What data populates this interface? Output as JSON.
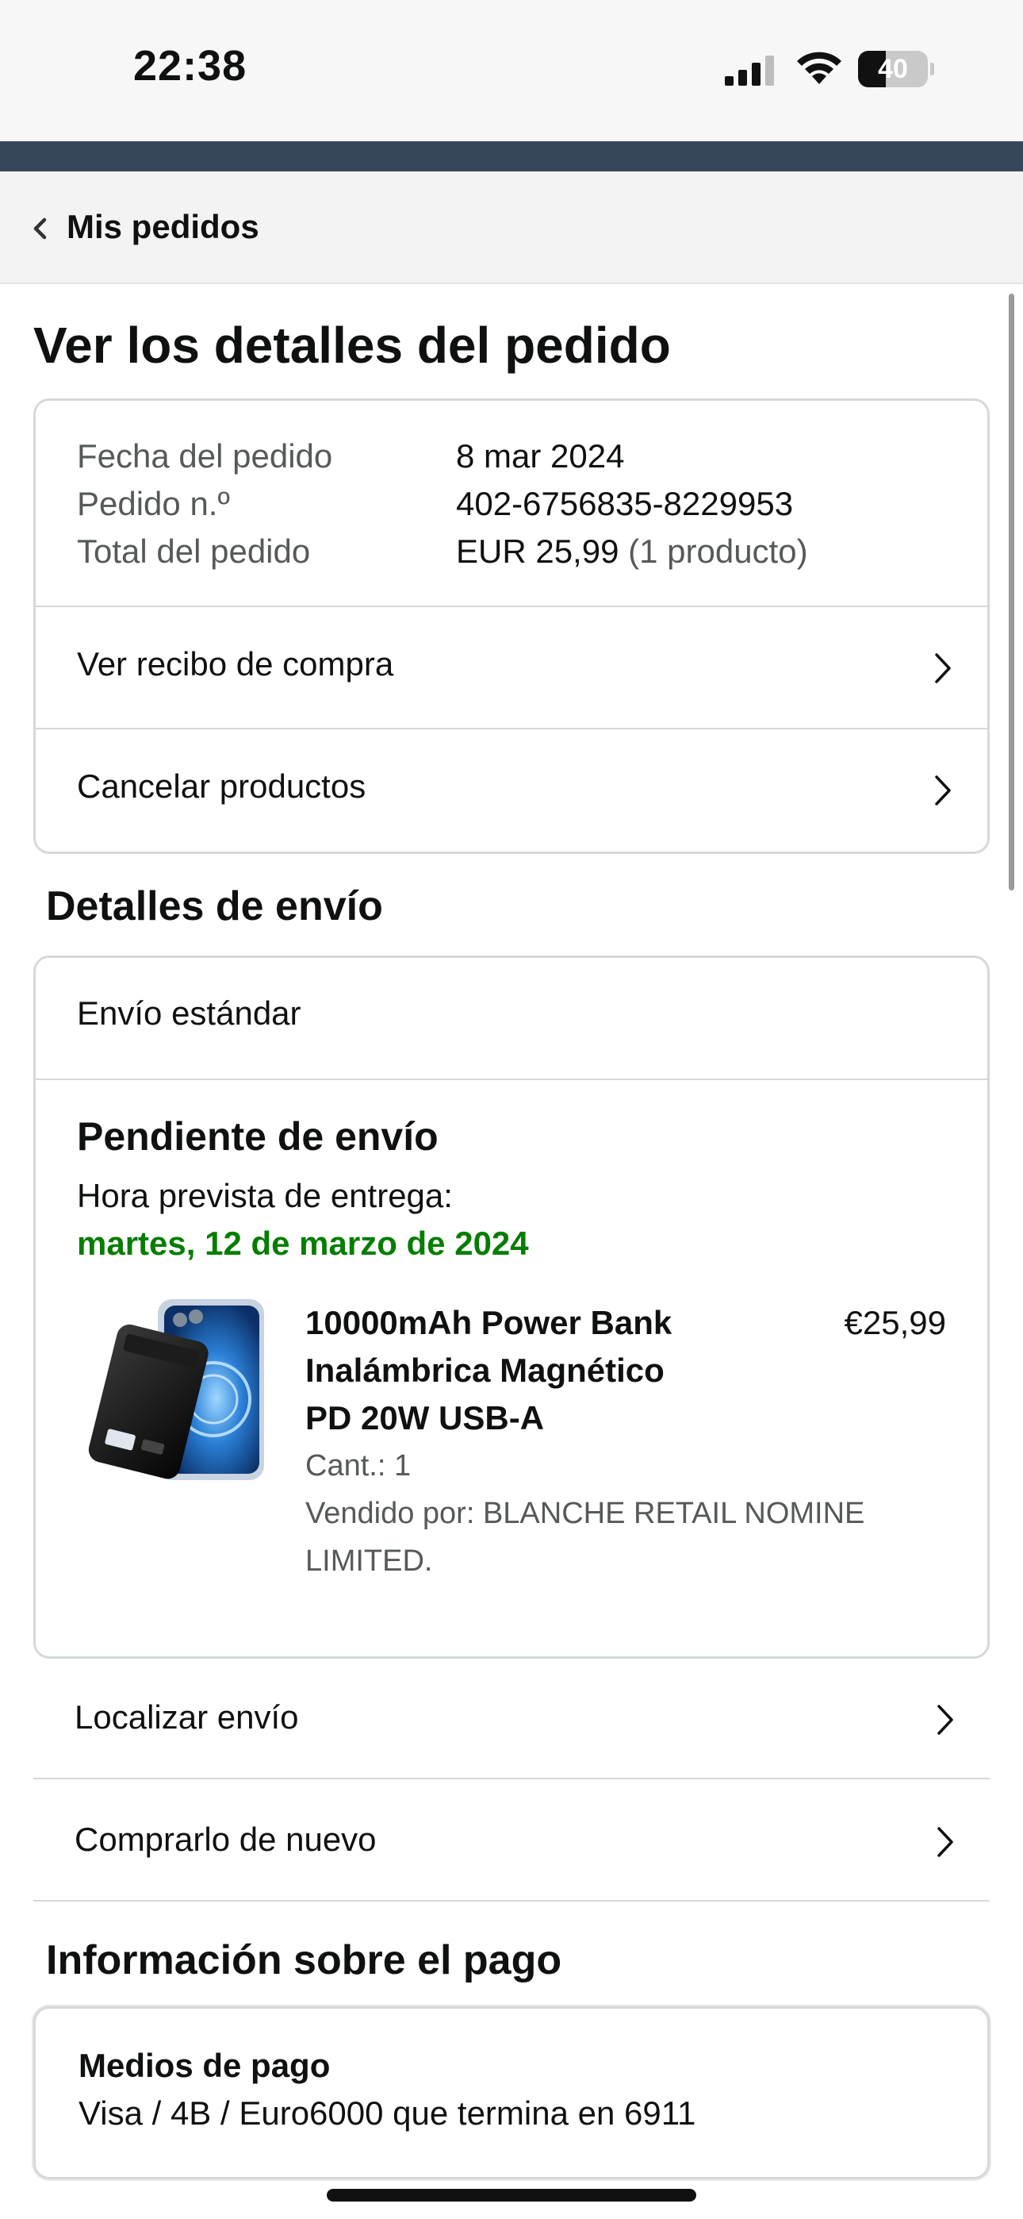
{
  "status_bar": {
    "time": "22:38",
    "battery_percent": "40",
    "battery_level": 0.4
  },
  "nav": {
    "back_label": "Mis pedidos"
  },
  "page": {
    "title": "Ver los detalles del pedido"
  },
  "order_summary": {
    "rows": [
      {
        "label": "Fecha del pedido",
        "value": "8 mar 2024",
        "extra": ""
      },
      {
        "label": "Pedido n.º",
        "value": "402-6756835-8229953",
        "extra": ""
      },
      {
        "label": "Total del pedido",
        "value": "EUR 25,99",
        "extra": "(1 producto)"
      }
    ],
    "actions": [
      "Ver recibo de compra",
      "Cancelar productos"
    ]
  },
  "shipping": {
    "section_title": "Detalles de envío",
    "type": "Envío estándar",
    "status": "Pendiente de envío",
    "eta_label": "Hora prevista de entrega:",
    "eta_date": "martes, 12 de marzo de 2024",
    "product": {
      "title_lines": [
        "10000mAh Power Bank",
        "Inalámbrica Magnético",
        "PD 20W USB-A"
      ],
      "price": "€25,99",
      "quantity": "Cant.: 1",
      "seller_lines": [
        "Vendido por: BLANCHE RETAIL NOMINE",
        "LIMITED."
      ],
      "image_icon": "power-bank-product-image"
    },
    "actions": [
      "Localizar envío",
      "Comprarlo de nuevo"
    ]
  },
  "payment": {
    "section_title": "Información sobre el pago",
    "method_title": "Medios de pago",
    "method_value": "Visa / 4B / Euro6000  que termina en 6911"
  },
  "colors": {
    "eta_green": "#067d00",
    "header_band": "#37475a",
    "muted_text": "#565959",
    "border": "#d5d9d9"
  }
}
